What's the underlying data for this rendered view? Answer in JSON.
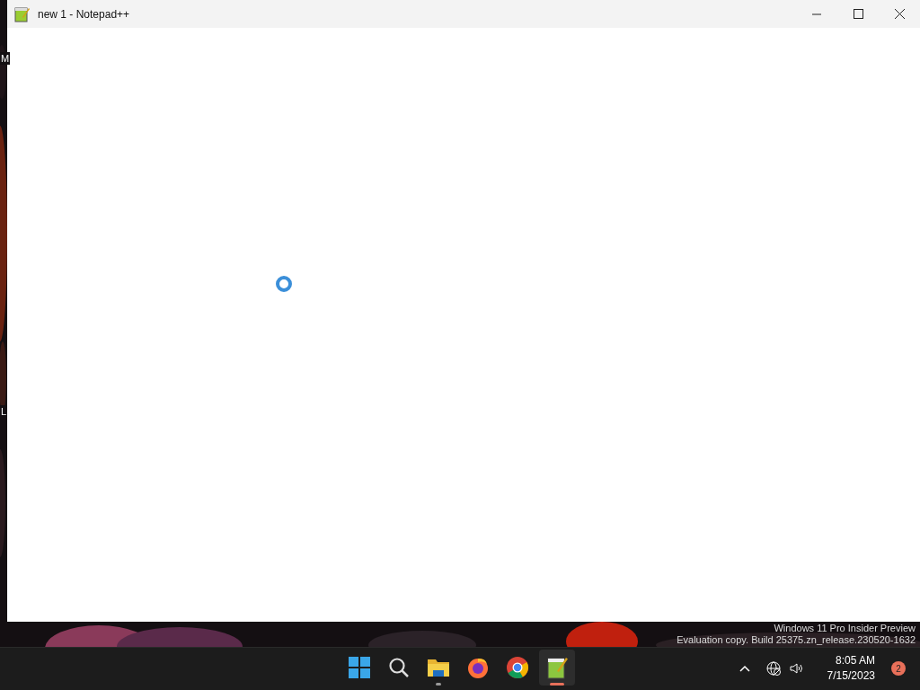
{
  "desktop": {
    "icon_labels": [
      "M",
      "L"
    ],
    "watermark": [
      "Windows 11 Pro Insider Preview",
      "Evaluation copy. Build 25375.zn_release.230520-1632"
    ]
  },
  "window": {
    "title": "new 1 - Notepad++",
    "loading": true
  },
  "taskbar": {
    "apps": [
      {
        "kind": "start",
        "running": false,
        "active": false
      },
      {
        "kind": "search",
        "running": false,
        "active": false
      },
      {
        "kind": "explorer",
        "running": true,
        "active": false
      },
      {
        "kind": "firefox",
        "running": false,
        "active": false
      },
      {
        "kind": "chrome",
        "running": false,
        "active": false
      },
      {
        "kind": "notepad",
        "running": true,
        "active": true
      }
    ]
  },
  "tray": {
    "time": "8:05 AM",
    "date": "7/15/2023",
    "notification_count": "2"
  }
}
